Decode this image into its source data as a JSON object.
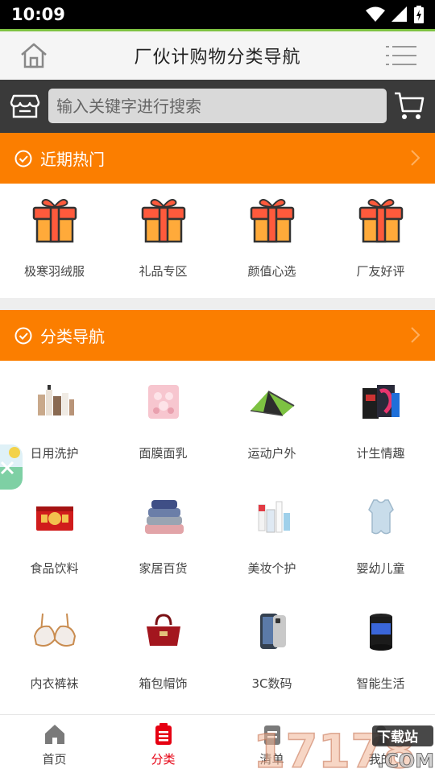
{
  "status": {
    "time": "10:09"
  },
  "header": {
    "title": "厂伙计购物分类导航"
  },
  "search": {
    "placeholder": "输入关键字进行搜索"
  },
  "hot_section": {
    "title": "近期热门",
    "items": [
      {
        "label": "极寒羽绒服",
        "icon": "gift-icon"
      },
      {
        "label": "礼品专区",
        "icon": "gift-icon"
      },
      {
        "label": "颜值心选",
        "icon": "gift-icon"
      },
      {
        "label": "厂友好评",
        "icon": "gift-icon"
      }
    ]
  },
  "category_section": {
    "title": "分类导航",
    "items": [
      {
        "label": "日用洗护",
        "icon": "toiletries-image"
      },
      {
        "label": "面膜面乳",
        "icon": "face-mask-image"
      },
      {
        "label": "运动户外",
        "icon": "tent-image"
      },
      {
        "label": "计生情趣",
        "icon": "adult-products-image"
      },
      {
        "label": "食品饮料",
        "icon": "food-gift-box-image"
      },
      {
        "label": "家居百货",
        "icon": "towels-image"
      },
      {
        "label": "美妆个护",
        "icon": "cosmetics-image"
      },
      {
        "label": "婴幼儿童",
        "icon": "baby-romper-image"
      },
      {
        "label": "内衣裤袜",
        "icon": "bra-image"
      },
      {
        "label": "箱包帽饰",
        "icon": "handbag-image"
      },
      {
        "label": "3C数码",
        "icon": "phone-image"
      },
      {
        "label": "智能生活",
        "icon": "smart-device-image"
      }
    ]
  },
  "bottom_nav": {
    "items": [
      {
        "label": "首页",
        "icon": "home-icon"
      },
      {
        "label": "分类",
        "icon": "category-icon",
        "active": true
      },
      {
        "label": "清单",
        "icon": "list-icon"
      },
      {
        "label": "我的",
        "icon": "user-icon"
      }
    ]
  },
  "watermark": {
    "text": "17178",
    "suffix": ".COM",
    "tag": "下载站"
  },
  "colors": {
    "accent": "#fb7e00",
    "active": "#e60012",
    "status_green": "#7ec242",
    "search_bg": "#3a3a3a"
  }
}
